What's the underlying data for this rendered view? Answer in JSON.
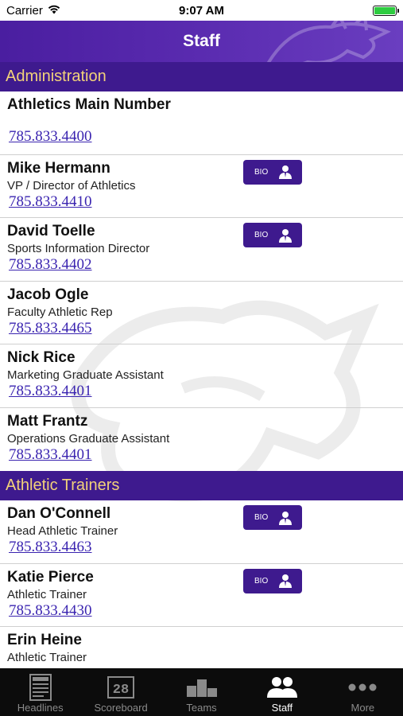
{
  "status_bar": {
    "carrier": "Carrier",
    "time": "9:07 AM"
  },
  "header": {
    "title": "Staff"
  },
  "sections": [
    {
      "title": "Administration",
      "rows": [
        {
          "name": "Athletics Main Number",
          "title": "",
          "phone": "785.833.4400",
          "bio": false
        },
        {
          "name": "Mike Hermann",
          "title": "VP / Director of Athletics",
          "phone": "785.833.4410",
          "bio": true
        },
        {
          "name": "David Toelle",
          "title": "Sports Information Director",
          "phone": "785.833.4402",
          "bio": true
        },
        {
          "name": "Jacob Ogle",
          "title": "Faculty Athletic Rep",
          "phone": "785.833.4465",
          "bio": false
        },
        {
          "name": "Nick Rice",
          "title": "Marketing Graduate Assistant",
          "phone": "785.833.4401",
          "bio": false
        },
        {
          "name": "Matt Frantz",
          "title": "Operations Graduate Assistant",
          "phone": "785.833.4401",
          "bio": false
        }
      ]
    },
    {
      "title": "Athletic Trainers",
      "rows": [
        {
          "name": "Dan O'Connell",
          "title": "Head Athletic Trainer",
          "phone": "785.833.4463",
          "bio": true
        },
        {
          "name": "Katie Pierce",
          "title": "Athletic Trainer",
          "phone": "785.833.4430",
          "bio": true
        },
        {
          "name": "Erin Heine",
          "title": "Athletic Trainer",
          "phone": "",
          "bio": false
        }
      ]
    }
  ],
  "bio_label": "BIO",
  "tabs": [
    {
      "label": "Headlines",
      "icon": "newspaper-icon",
      "active": false
    },
    {
      "label": "Scoreboard",
      "icon": "scoreboard-icon",
      "active": false
    },
    {
      "label": "Teams",
      "icon": "podium-icon",
      "active": false
    },
    {
      "label": "Staff",
      "icon": "people-icon",
      "active": true
    },
    {
      "label": "More",
      "icon": "more-dots-icon",
      "active": false
    }
  ],
  "colors": {
    "brand_purple": "#3e1a8e",
    "section_text": "#f2d27a",
    "link": "#3a24b0",
    "tab_bg": "#0c0c0c"
  }
}
